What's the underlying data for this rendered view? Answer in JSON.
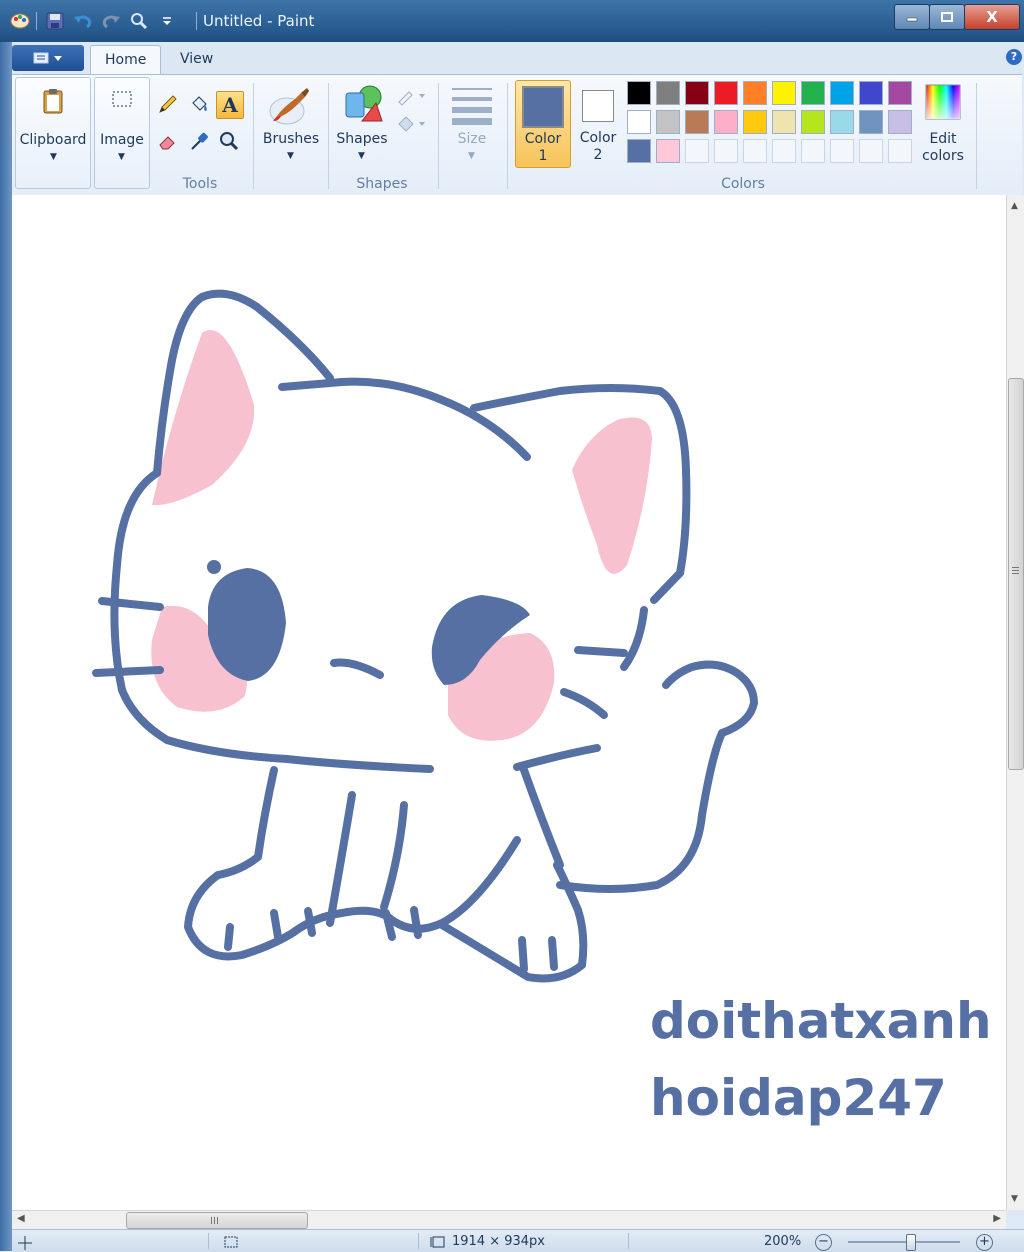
{
  "window": {
    "title": "Untitled - Paint",
    "minimize_label": "—",
    "maximize_label": "□",
    "close_label": "X"
  },
  "tabs": [
    {
      "label": "Home",
      "active": true
    },
    {
      "label": "View",
      "active": false
    }
  ],
  "help_label": "?",
  "ribbon": {
    "clipboard": {
      "label": "Clipboard"
    },
    "image": {
      "label": "Image"
    },
    "tools": {
      "group_label": "Tools",
      "icons": [
        "pencil-icon",
        "fill-icon",
        "text-icon",
        "eraser-icon",
        "color-picker-icon",
        "magnifier-icon"
      ]
    },
    "brushes": {
      "label": "Brushes"
    },
    "shapes": {
      "label": "Shapes",
      "group_label": "Shapes"
    },
    "size": {
      "label": "Size"
    },
    "color1": {
      "label_line1": "Color",
      "label_line2": "1",
      "value": "#5670a3"
    },
    "color2": {
      "label_line1": "Color",
      "label_line2": "2",
      "value": "#ffffff"
    },
    "colors_group_label": "Colors",
    "edit_colors": {
      "label_line1": "Edit",
      "label_line2": "colors"
    },
    "palette": [
      [
        "#000000",
        "#7f7f7f",
        "#880015",
        "#ed1c24",
        "#ff7f27",
        "#fff200",
        "#22b14c",
        "#00a2e8",
        "#3f48cc",
        "#a349a4"
      ],
      [
        "#ffffff",
        "#c3c3c3",
        "#b97a57",
        "#ffaec9",
        "#ffc90e",
        "#efe4b0",
        "#b5e61d",
        "#99d9ea",
        "#7092be",
        "#c8bfe7"
      ],
      [
        "#5670a3",
        "#ffc8d8",
        "",
        "",
        "",
        "",
        "",
        "",
        "",
        ""
      ]
    ]
  },
  "canvas": {
    "line_color": "#5670a3",
    "pink_color": "#f8c1d0",
    "text_lines": [
      "doithatxanh",
      "hoidap247"
    ]
  },
  "statusbar": {
    "size_text": "1914 × 934px",
    "zoom_text": "200%",
    "zoom_fraction": 0.55
  }
}
